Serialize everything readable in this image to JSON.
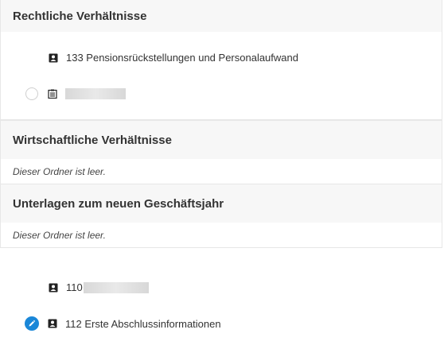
{
  "sections": [
    {
      "title": "Rechtliche Verhältnisse"
    },
    {
      "title": "Wirtschaftliche Verhältnisse",
      "empty_note": "Dieser Ordner ist leer."
    },
    {
      "title": "Unterlagen zum neuen Geschäftsjahr",
      "empty_note": "Dieser Ordner ist leer."
    }
  ],
  "rechtliche_items": [
    {
      "label": "133 Pensionsrückstellungen und Personalaufwand",
      "icon": "person-document-icon"
    },
    {
      "label": "",
      "icon": "clipboard-icon",
      "redacted": true
    }
  ],
  "root_items": [
    {
      "label": "110",
      "icon": "person-document-icon",
      "redacted": true
    },
    {
      "label": "112 Erste Abschlussinformationen",
      "icon": "person-document-icon",
      "edit_icon": "pencil-icon"
    }
  ],
  "colors": {
    "accent": "#1a87d8",
    "header_bg": "#f7f7f7",
    "border": "#e7e7e7"
  }
}
